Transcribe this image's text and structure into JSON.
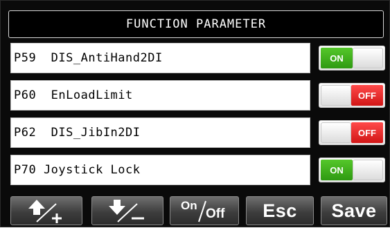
{
  "screen": {
    "title": "FUNCTION PARAMETER"
  },
  "parameters": [
    {
      "code": "P59",
      "name": "DIS_AntiHand2DI",
      "label": "P59  DIS_AntiHand2DI",
      "state": "ON"
    },
    {
      "code": "P60",
      "name": "EnLoadLimit",
      "label": "P60  EnLoadLimit",
      "state": "OFF"
    },
    {
      "code": "P62",
      "name": "DIS_JibIn2DI",
      "label": "P62  DIS_JibIn2DI",
      "state": "OFF"
    },
    {
      "code": "P70",
      "name": "Joystick Lock",
      "label": "P70 Joystick Lock",
      "state": "ON"
    }
  ],
  "toolbar": {
    "up_plus_icon": "arrow-up-plus-icon",
    "down_minus_icon": "arrow-down-minus-icon",
    "onoff_on": "On",
    "onoff_off": "Off",
    "esc_label": "Esc",
    "save_label": "Save"
  },
  "colors": {
    "on": "#3aa81a",
    "off": "#e02020",
    "background": "#000000"
  }
}
